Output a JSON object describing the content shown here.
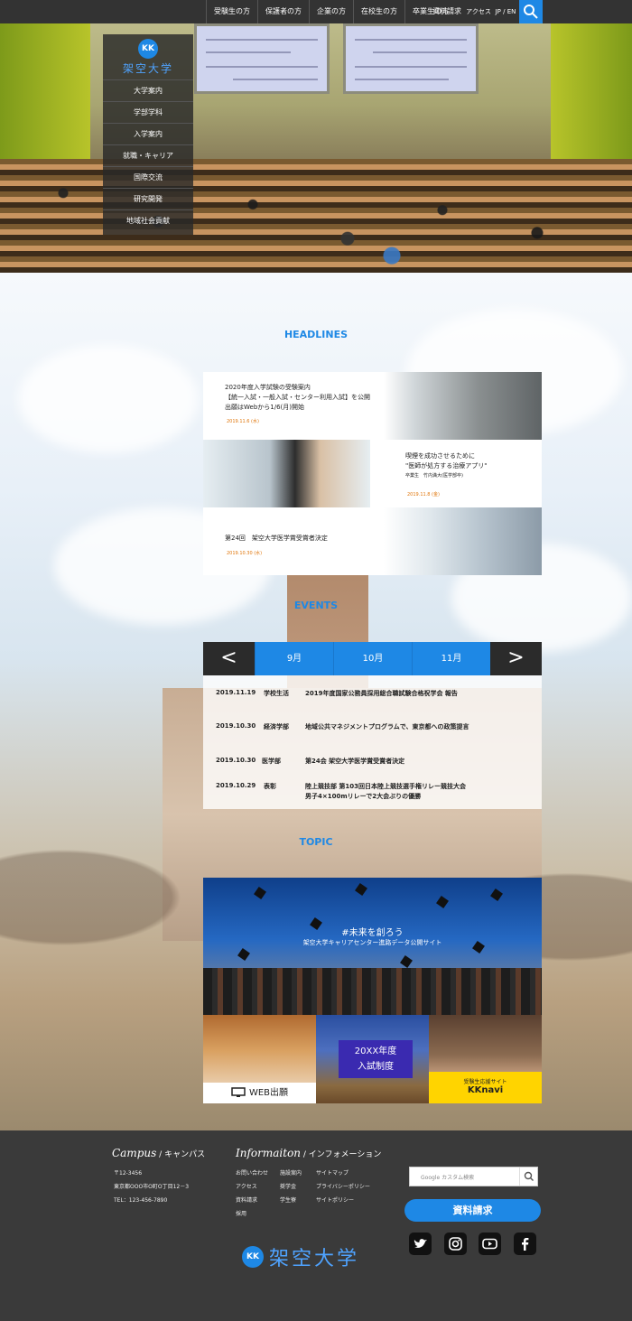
{
  "topnav": {
    "items": [
      "受験生の方",
      "保護者の方",
      "企業の方",
      "在校生の方",
      "卒業生の方"
    ],
    "request": "資料請求",
    "access": "アクセス",
    "lang": "JP / EN"
  },
  "sidebar": {
    "logo_mark": "KK",
    "logo_name": "架空大学",
    "items": [
      "大学案内",
      "学部学科",
      "入学案内",
      "就職・キャリア",
      "国際交流",
      "研究開発",
      "地域社会貢献"
    ]
  },
  "headlines": {
    "title": "HEADLINES",
    "items": [
      {
        "text1": "2020年度入学試験の受験案内",
        "text2": "【統一入試・一般入試・センター利用入試】を公開",
        "text3": "出願はWebから1/6(月)開始",
        "date": "2019.11.6 (水)"
      },
      {
        "text1": "喫煙を成功させるために",
        "text2": "\"医師が処方する治療アプリ\"",
        "text3": "卒業生　竹内満大(医学部卒)",
        "date": "2019.11.8 (金)"
      },
      {
        "text1": "第24回　架空大学医学賞受賞者決定",
        "date": "2019.10.30 (水)"
      }
    ]
  },
  "events": {
    "title": "EVENTS",
    "prev": "<",
    "next": ">",
    "months": [
      "9月",
      "10月",
      "11月"
    ],
    "items": [
      {
        "date": "2019.11.19",
        "cat": "学校生活",
        "text": "2019年度国家公務員採用総合職試験合格祝学会 報告",
        "text2": ""
      },
      {
        "date": "2019.10.30",
        "cat": "経済学部",
        "text": "地域公共マネジメントプログラムで、東京都への政策提言",
        "text2": ""
      },
      {
        "date": "2019.10.30",
        "cat": "医学部",
        "text": "第24会 架空大学医学賞受賞者決定",
        "text2": ""
      },
      {
        "date": "2019.10.29",
        "cat": "表彰",
        "text": "陸上競技部 第103回日本陸上競技選手権リレー競技大会",
        "text2": "男子4×100mリレーで2大会ぶりの優勝"
      }
    ]
  },
  "topic": {
    "title": "TOPIC",
    "banner_line1": "#未来を創ろう",
    "banner_line2": "架空大学キャリアセンター進路データ公開サイト",
    "tile1_label": "WEB出願",
    "tile2_line1": "20XX年度",
    "tile2_line2": "入試制度",
    "tile3_small": "受験生応援サイト",
    "tile3_big": "KKnavi"
  },
  "footer": {
    "campus_en": "Campus",
    "campus_jp": "/ キャンパス",
    "campus_lines": [
      "〒12-3456",
      "東京都OOO市O町O丁目12－3",
      "TEL：123-456-7890"
    ],
    "info_en": "Informaiton",
    "info_jp": "/ インフォメーション",
    "col1": [
      "お問い合わせ",
      "アクセス",
      "資料請求",
      "採用"
    ],
    "col2": [
      "施設案内",
      "奨学金",
      "学生寮"
    ],
    "col3": [
      "サイトマップ",
      "プライバシーポリシー",
      "サイトポリシー"
    ],
    "search_placeholder": "Google カスタム検索",
    "request_button": "資料請求",
    "logo_mark": "KK",
    "logo_name": "架空大学",
    "social": [
      "twitter-icon",
      "instagram-icon",
      "youtube-icon",
      "facebook-icon"
    ]
  },
  "colors": {
    "accent": "#1e88e5",
    "dark": "#333333",
    "orange": "#e0760b",
    "yellow": "#ffd400"
  }
}
